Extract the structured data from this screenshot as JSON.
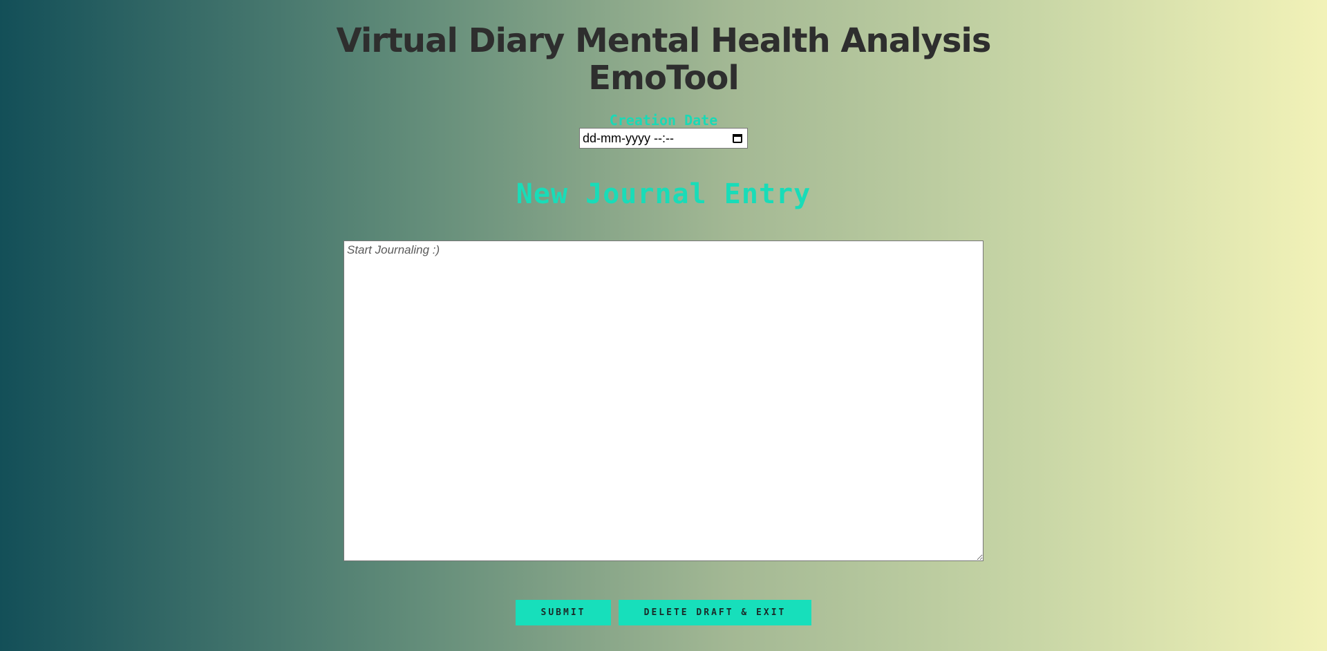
{
  "header": {
    "title_line1": "Virtual Diary Mental Health Analysis",
    "title_line2": "EmoTool"
  },
  "date": {
    "label": "Creation Date",
    "placeholder": "dd-mm-yyyy --:--",
    "icon": "calendar-icon"
  },
  "entry": {
    "heading": "New Journal Entry",
    "placeholder": "Start Journaling :)"
  },
  "actions": {
    "submit_label": "SUBMIT",
    "delete_label": "DELETE DRAFT & EXIT"
  },
  "colors": {
    "accent": "#17dfbb",
    "title": "#2e2e2e",
    "gradient_start": "#134f58",
    "gradient_end": "#f2f2b8"
  }
}
